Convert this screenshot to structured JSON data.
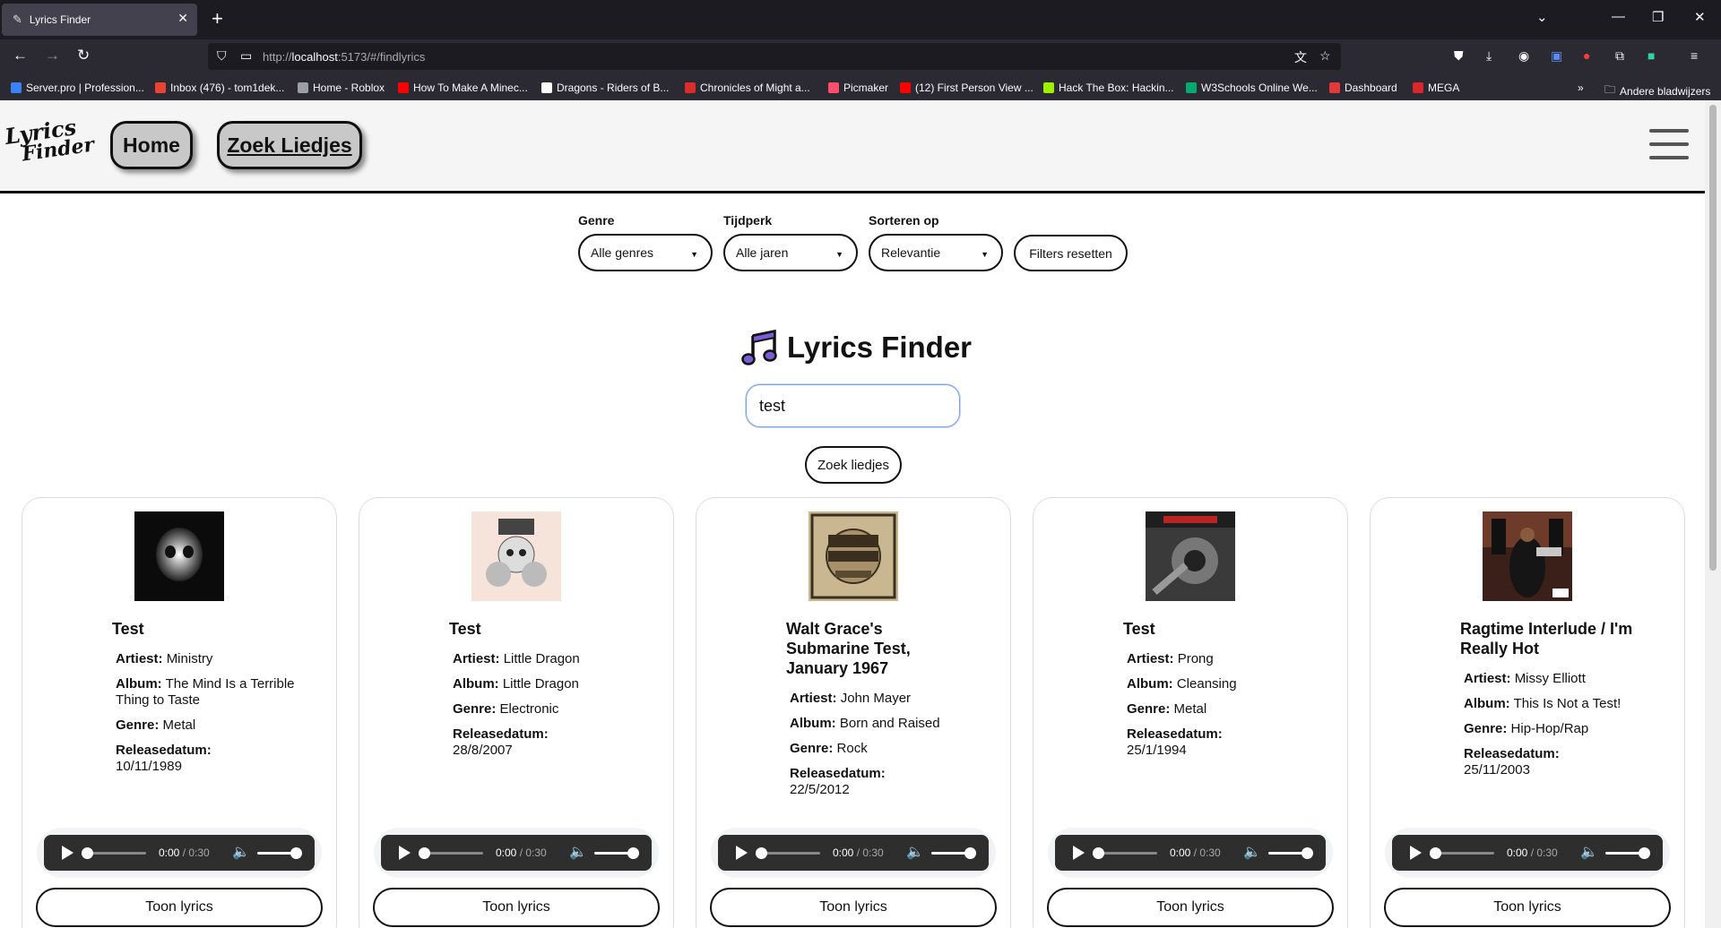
{
  "browser": {
    "tab_title": "Lyrics Finder",
    "url_prefix": "http://",
    "url_host": "localhost",
    "url_path": ":5173/#/findlyrics",
    "bookmarks": [
      {
        "label": "Server.pro | Profession...",
        "color": "#3b82f6"
      },
      {
        "label": "Inbox (476) - tom1dek...",
        "color": "#ea4335"
      },
      {
        "label": "Home - Roblox",
        "color": "#9aa0a6"
      },
      {
        "label": "How To Make A Minec...",
        "color": "#ff0000"
      },
      {
        "label": "Dragons - Riders of B...",
        "color": "#ffffff"
      },
      {
        "label": "Chronicles of Might a...",
        "color": "#d92c2c"
      },
      {
        "label": "Picmaker",
        "color": "#ff4f6d"
      },
      {
        "label": "(12) First Person View ...",
        "color": "#ff0000"
      },
      {
        "label": "Hack The Box: Hackin...",
        "color": "#9fef00"
      },
      {
        "label": "W3Schools Online We...",
        "color": "#04aa6d"
      },
      {
        "label": "Dashboard",
        "color": "#e5383b"
      },
      {
        "label": "MEGA",
        "color": "#d9272e"
      }
    ],
    "other_bookmarks": "Andere bladwijzers"
  },
  "header": {
    "logo_line1": "Lyrics",
    "logo_line2": "Finder",
    "nav": [
      {
        "label": "Home"
      },
      {
        "label": "Zoek Liedjes"
      }
    ]
  },
  "filters": {
    "genre_label": "Genre",
    "genre_value": "Alle genres",
    "era_label": "Tijdperk",
    "era_value": "Alle jaren",
    "sort_label": "Sorteren op",
    "sort_value": "Relevantie",
    "reset_label": "Filters resetten"
  },
  "main": {
    "title": "Lyrics Finder",
    "search_value": "test",
    "search_button": "Zoek liedjes"
  },
  "labels": {
    "artist": "Artiest:",
    "album": "Album:",
    "genre": "Genre:",
    "release": "Releasedatum:"
  },
  "player": {
    "current": "0:00",
    "duration": "/ 0:30"
  },
  "results": [
    {
      "title": "Test",
      "artist": "Ministry",
      "album": "The Mind Is a Terrible Thing to Taste",
      "genre": "Metal",
      "release": "10/11/1989",
      "button": "Toon lyrics"
    },
    {
      "title": "Test",
      "artist": "Little Dragon",
      "album": "Little Dragon",
      "genre": "Electronic",
      "release": "28/8/2007",
      "button": "Toon lyrics"
    },
    {
      "title": "Walt Grace's Submarine Test, January 1967",
      "artist": "John Mayer",
      "album": "Born and Raised",
      "genre": "Rock",
      "release": "22/5/2012",
      "button": "Toon lyrics"
    },
    {
      "title": "Test",
      "artist": "Prong",
      "album": "Cleansing",
      "genre": "Metal",
      "release": "25/1/1994",
      "button": "Toon lyrics"
    },
    {
      "title": "Ragtime Interlude / I'm Really Hot",
      "artist": "Missy Elliott",
      "album": "This Is Not a Test!",
      "genre": "Hip-Hop/Rap",
      "release": "25/11/2003",
      "button": "Toon lyrics"
    }
  ]
}
